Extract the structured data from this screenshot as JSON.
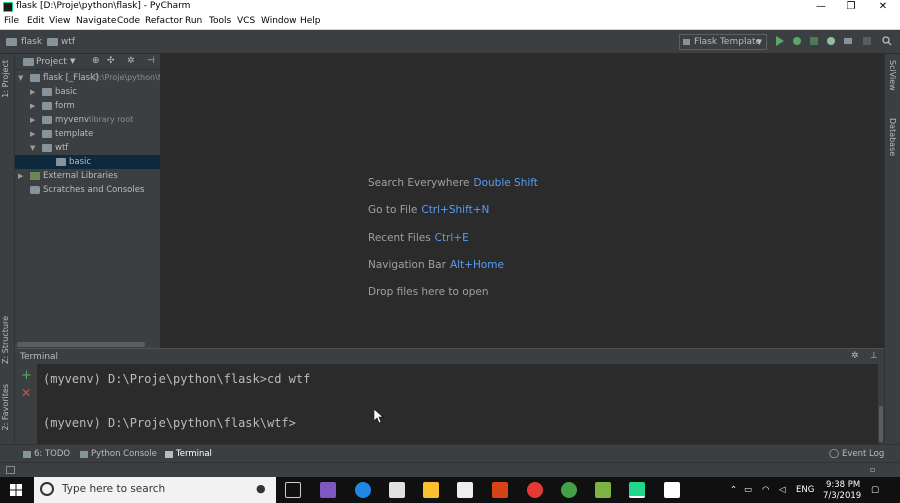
{
  "window": {
    "title": "flask [D:\\Proje\\python\\flask] - PyCharm",
    "minimize": "—",
    "restore": "❐",
    "close": "✕"
  },
  "menu": [
    "File",
    "Edit",
    "View",
    "Navigate",
    "Code",
    "Refactor",
    "Run",
    "Tools",
    "VCS",
    "Window",
    "Help"
  ],
  "breadcrumb": [
    "flask",
    "wtf"
  ],
  "run_config": "Flask Template",
  "left_tabs": [
    "1: Project",
    "Z: Structure",
    "2: Favorites"
  ],
  "right_tabs": [
    "SciView",
    "Database"
  ],
  "project_panel": {
    "title": "Project",
    "tree": [
      {
        "label": "flask [_Flask]",
        "hint": "D:\\Proje\\python\\f",
        "arrow": "▼"
      },
      {
        "label": "basic",
        "hint": "",
        "arrow": "▶"
      },
      {
        "label": "form",
        "hint": "",
        "arrow": "▶"
      },
      {
        "label": "myvenv",
        "hint": "library root",
        "arrow": "▶"
      },
      {
        "label": "template",
        "hint": "",
        "arrow": "▶"
      },
      {
        "label": "wtf",
        "hint": "",
        "arrow": "▼"
      },
      {
        "label": "basic",
        "hint": "",
        "arrow": ""
      },
      {
        "label": "External Libraries",
        "hint": "",
        "arrow": "▶"
      },
      {
        "label": "Scratches and Consoles",
        "hint": "",
        "arrow": ""
      }
    ]
  },
  "editor_welcome": [
    {
      "label": "Search Everywhere",
      "key": "Double Shift"
    },
    {
      "label": "Go to File",
      "key": "Ctrl+Shift+N"
    },
    {
      "label": "Recent Files",
      "key": "Ctrl+E"
    },
    {
      "label": "Navigation Bar",
      "key": "Alt+Home"
    },
    {
      "label": "Drop files here to open",
      "key": ""
    }
  ],
  "terminal": {
    "title": "Terminal",
    "lines": [
      "(myvenv) D:\\Proje\\python\\flask>cd wtf",
      "(myvenv) D:\\Proje\\python\\flask\\wtf>"
    ]
  },
  "bottom_tabs": [
    "6: TODO",
    "Python Console",
    "Terminal"
  ],
  "event_log": "Event Log",
  "taskbar": {
    "search_placeholder": "Type here to search",
    "lang": "ENG",
    "time": "9:38 PM",
    "date": "7/3/2019"
  },
  "colors": {
    "accent": "#589df6",
    "selection": "#0d293e",
    "run_green": "#59a869"
  }
}
